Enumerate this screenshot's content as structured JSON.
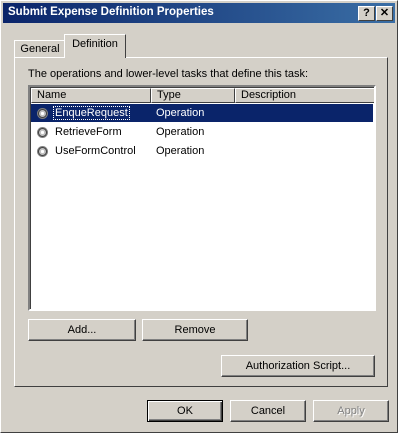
{
  "window": {
    "title": "Submit Expense Definition Properties",
    "help_glyph": "?",
    "close_glyph": "✕"
  },
  "tabs": [
    {
      "label": "General",
      "selected": false
    },
    {
      "label": "Definition",
      "selected": true
    }
  ],
  "definition": {
    "description": "The operations and lower-level tasks that define this task:",
    "columns": [
      "Name",
      "Type",
      "Description"
    ],
    "rows": [
      {
        "name": "EnqueRequest",
        "type": "Operation",
        "description": "",
        "icon": "operation-gear-icon",
        "selected": true
      },
      {
        "name": "RetrieveForm",
        "type": "Operation",
        "description": "",
        "icon": "operation-gear-icon",
        "selected": false
      },
      {
        "name": "UseFormControl",
        "type": "Operation",
        "description": "",
        "icon": "operation-gear-icon",
        "selected": false
      }
    ],
    "add_label": "Add...",
    "remove_label": "Remove",
    "authorization_label": "Authorization Script..."
  },
  "footer": {
    "ok_label": "OK",
    "cancel_label": "Cancel",
    "apply_label": "Apply"
  },
  "colors": {
    "title_bar": "#0a246a",
    "selection": "#0a246a",
    "face": "#d4d0c8"
  }
}
